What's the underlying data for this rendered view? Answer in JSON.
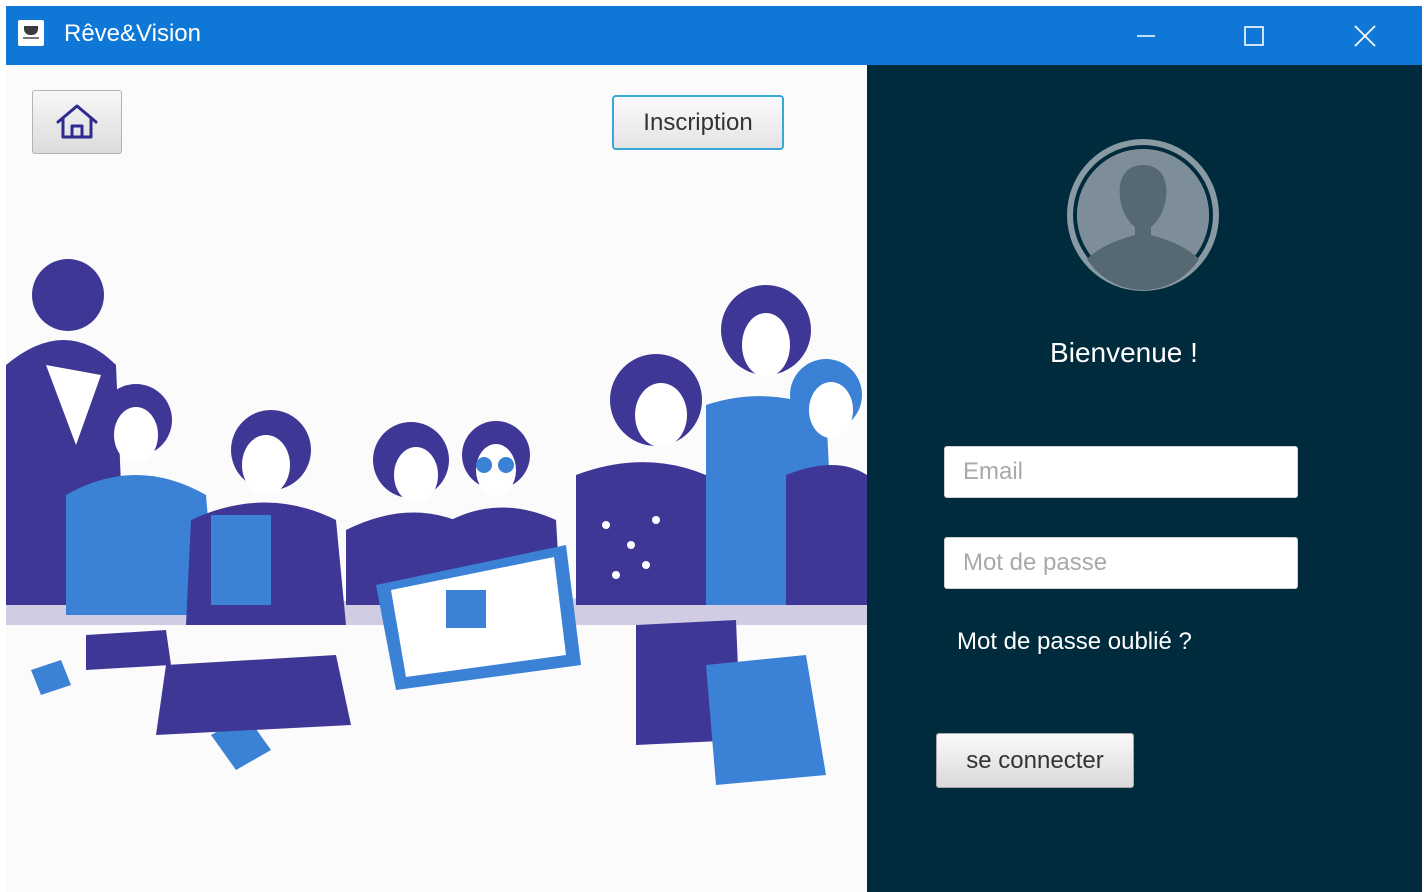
{
  "window": {
    "title": "Rêve&Vision",
    "titlebar_color": "#0f78d6",
    "controls": [
      "minimize-icon",
      "maximize-icon",
      "close-icon"
    ]
  },
  "left_panel": {
    "home_icon": "home-icon",
    "signup_label": "Inscription",
    "illustration": "group-of-people-illustration"
  },
  "right_panel": {
    "background": "#002b3c",
    "avatar_icon": "user-avatar-icon",
    "welcome_text": "Bienvenue !",
    "email_placeholder": "Email",
    "password_placeholder": "Mot de passe",
    "forgot_password_label": "Mot de passe oublié ?",
    "login_label": "se connecter"
  }
}
